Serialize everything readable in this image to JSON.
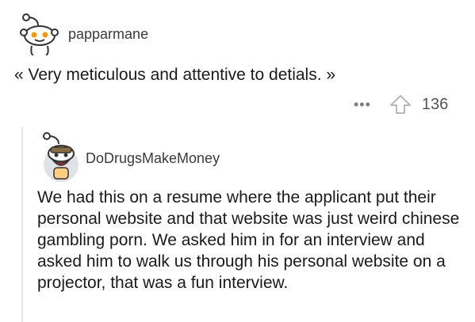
{
  "comment_top": {
    "username": "papparmane",
    "text": "« Very meticulous and attentive to detials. »",
    "more_glyph": "•••",
    "score": "136"
  },
  "comment_reply": {
    "username": "DoDrugsMakeMoney",
    "text": "We had this on a resume where the applicant put their personal website and that website was just weird chinese gambling porn. We asked him in for an interview and asked him to walk us through his personal website on a projector, that was a fun interview."
  },
  "colors": {
    "text": "#1a1a1b",
    "meta": "#7c7c7c",
    "thread_line": "#e6e6e6"
  },
  "icons": [
    "snoo-avatar-icon",
    "snoo-costume-avatar-icon",
    "upvote-arrow-icon",
    "more-options-icon"
  ]
}
